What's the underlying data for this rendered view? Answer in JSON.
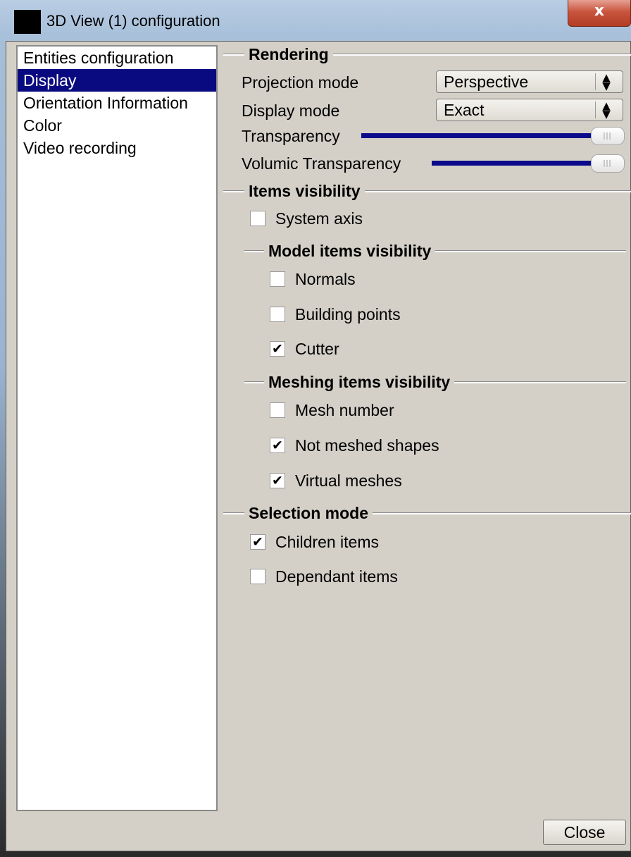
{
  "window": {
    "title": "3D View (1) configuration",
    "close_glyph": "x"
  },
  "nav": {
    "items": [
      {
        "label": "Entities configuration",
        "selected": false
      },
      {
        "label": "Display",
        "selected": true
      },
      {
        "label": "Orientation Information",
        "selected": false
      },
      {
        "label": "Color",
        "selected": false
      },
      {
        "label": "Video recording",
        "selected": false
      }
    ]
  },
  "rendering": {
    "title": "Rendering",
    "projection_label": "Projection mode",
    "projection_value": "Perspective",
    "display_label": "Display mode",
    "display_value": "Exact",
    "transparency_label": "Transparency",
    "transparency_level": 1.0,
    "volumic_label": "Volumic Transparency",
    "volumic_level": 1.0
  },
  "visibility": {
    "title": "Items visibility",
    "system_axis": {
      "label": "System axis",
      "checked": false
    }
  },
  "model": {
    "title": "Model items visibility",
    "normals": {
      "label": "Normals",
      "checked": false
    },
    "building_points": {
      "label": "Building points",
      "checked": false
    },
    "cutter": {
      "label": "Cutter",
      "checked": true
    }
  },
  "meshing": {
    "title": "Meshing items visibility",
    "mesh_number": {
      "label": "Mesh number",
      "checked": false
    },
    "not_meshed": {
      "label": "Not meshed shapes",
      "checked": true
    },
    "virtual_meshes": {
      "label": "Virtual meshes",
      "checked": true
    }
  },
  "selection": {
    "title": "Selection mode",
    "children": {
      "label": "Children items",
      "checked": true
    },
    "dependant": {
      "label": "Dependant items",
      "checked": false
    }
  },
  "footer": {
    "close_label": "Close"
  },
  "glyphs": {
    "check": "✔",
    "updown": "▲▼"
  }
}
